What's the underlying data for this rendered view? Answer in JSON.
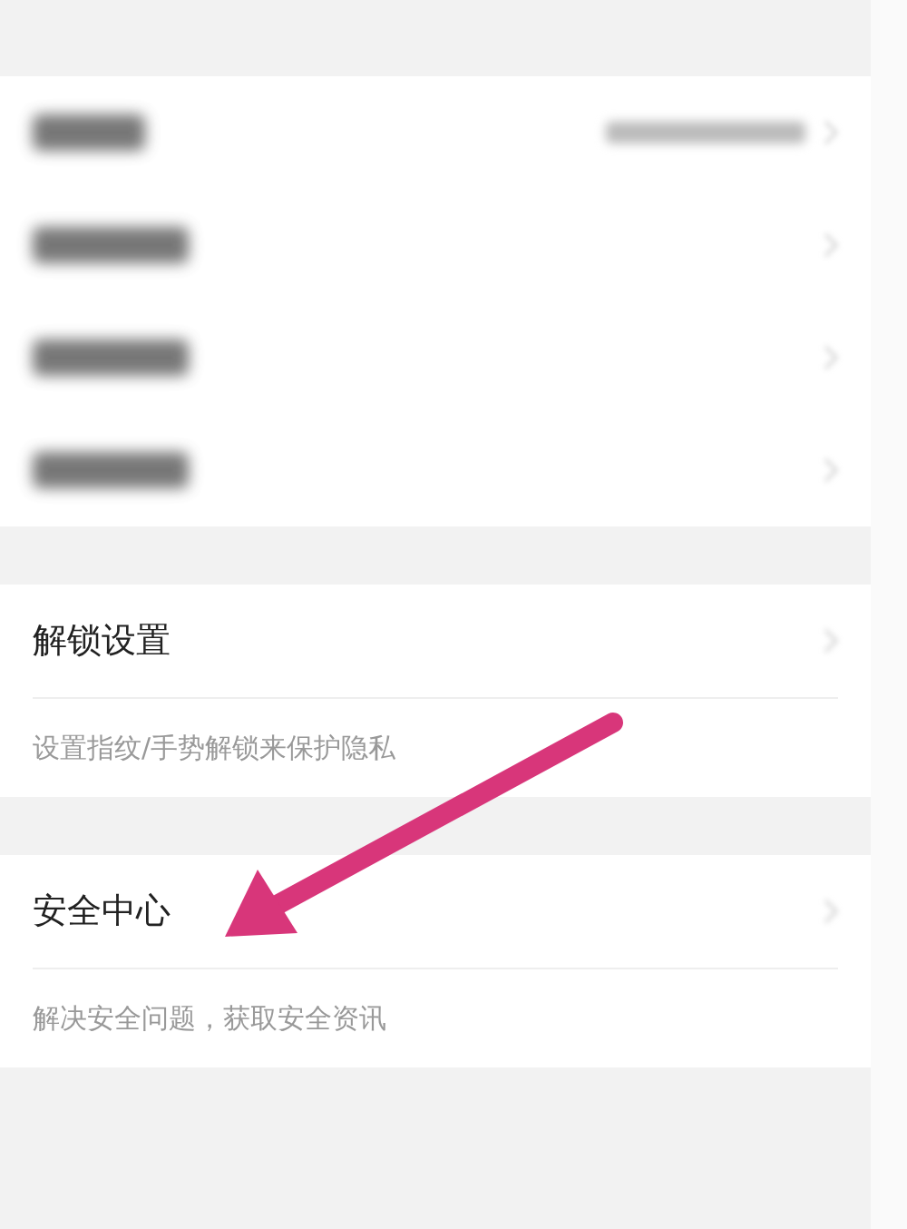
{
  "blurred_rows": [
    {
      "has_value": true
    },
    {
      "has_value": false
    },
    {
      "has_value": false
    },
    {
      "has_value": false
    }
  ],
  "sections": [
    {
      "title": "解锁设置",
      "description": "设置指纹/手势解锁来保护隐私"
    },
    {
      "title": "安全中心",
      "description": "解决安全问题，获取安全资讯"
    }
  ],
  "annotation": {
    "kind": "arrow",
    "color": "#d8367a"
  }
}
